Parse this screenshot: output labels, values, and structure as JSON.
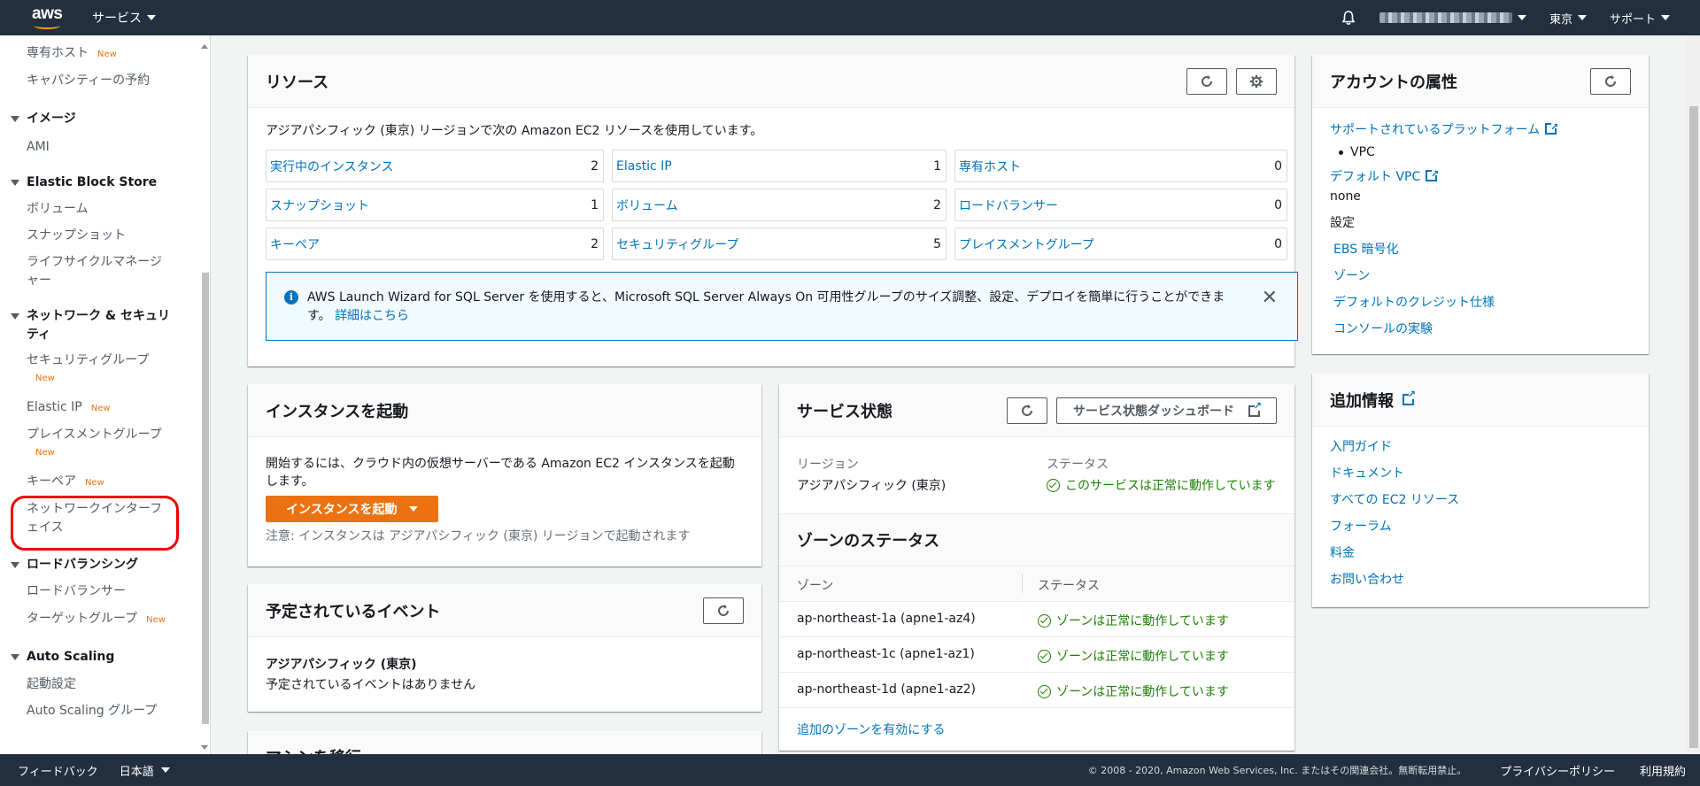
{
  "topnav": {
    "logo": "aws",
    "services": "サービス",
    "account": "",
    "region": "東京",
    "support": "サポート"
  },
  "sidebar": {
    "dedicated_hosts": "専有ホスト",
    "capacity_reservations": "キャパシティーの予約",
    "images_head": "イメージ",
    "ami": "AMI",
    "ebs_head": "Elastic Block Store",
    "volumes": "ボリューム",
    "snapshots": "スナップショット",
    "lifecycle_1": "ライフサイクルマネージ",
    "lifecycle_2": "ャー",
    "network_head_1": "ネットワーク & セキュリ",
    "network_head_2": "ティ",
    "security_groups": "セキュリティグループ",
    "elastic_ip": "Elastic IP",
    "placement_groups": "プレイスメントグループ",
    "key_pairs": "キーペア",
    "network_interfaces_1": "ネットワークインターフ",
    "network_interfaces_2": "ェイス",
    "lb_head": "ロードバランシング",
    "load_balancers": "ロードバランサー",
    "target_groups": "ターゲットグループ",
    "as_head": "Auto Scaling",
    "launch_config": "起動設定",
    "as_groups": "Auto Scaling グループ",
    "new_badge": "New"
  },
  "resources": {
    "title": "リソース",
    "intro": "アジアパシフィック (東京) リージョンで次の Amazon EC2 リソースを使用しています。",
    "cells": [
      {
        "label": "実行中のインスタンス",
        "count": "2"
      },
      {
        "label": "Elastic IP",
        "count": "1"
      },
      {
        "label": "専有ホスト",
        "count": "0"
      },
      {
        "label": "スナップショット",
        "count": "1"
      },
      {
        "label": "ボリューム",
        "count": "2"
      },
      {
        "label": "ロードバランサー",
        "count": "0"
      },
      {
        "label": "キーペア",
        "count": "2"
      },
      {
        "label": "セキュリティグループ",
        "count": "5"
      },
      {
        "label": "プレイスメントグループ",
        "count": "0"
      }
    ],
    "info_text": "AWS Launch Wizard for SQL Server を使用すると、Microsoft SQL Server Always On 可用性グループのサイズ調整、設定、デプロイを簡単に行うことができます。",
    "info_link": "詳細はこちら"
  },
  "account_attrs": {
    "title": "アカウントの属性",
    "supported_platforms": "サポートされているプラットフォーム",
    "vpc": "VPC",
    "default_vpc": "デフォルト VPC",
    "none": "none",
    "settings": "設定",
    "ebs_encryption": "EBS 暗号化",
    "zones": "ゾーン",
    "default_credit": "デフォルトのクレジット仕様",
    "console_experiments": "コンソールの実験"
  },
  "additional_info": {
    "title": "追加情報",
    "links": [
      "入門ガイド",
      "ドキュメント",
      "すべての EC2 リソース",
      "フォーラム",
      "料金",
      "お問い合わせ"
    ]
  },
  "launch": {
    "title": "インスタンスを起動",
    "desc": "開始するには、クラウド内の仮想サーバーである Amazon EC2 インスタンスを起動します。",
    "button": "インスタンスを起動",
    "note": "注意: インスタンスは アジアパシフィック (東京) リージョンで起動されます"
  },
  "events": {
    "title": "予定されているイベント",
    "region": "アジアパシフィック (東京)",
    "none": "予定されているイベントはありません"
  },
  "migrate": {
    "title": "マシンを移行"
  },
  "service_health": {
    "title": "サービス状態",
    "dashboard_button": "サービス状態ダッシュボード",
    "region_label": "リージョン",
    "region_value": "アジアパシフィック (東京)",
    "status_label": "ステータス",
    "status_value": "このサービスは正常に動作しています",
    "zone_status_title": "ゾーンのステータス",
    "col_zone": "ゾーン",
    "col_status": "ステータス",
    "zones": [
      {
        "zone": "ap-northeast-1a (apne1-az4)",
        "status": "ゾーンは正常に動作しています"
      },
      {
        "zone": "ap-northeast-1c (apne1-az1)",
        "status": "ゾーンは正常に動作しています"
      },
      {
        "zone": "ap-northeast-1d (apne1-az2)",
        "status": "ゾーンは正常に動作しています"
      }
    ],
    "enable_zones": "追加のゾーンを有効にする"
  },
  "footer": {
    "feedback": "フィードバック",
    "language": "日本語",
    "copyright": "© 2008 - 2020, Amazon Web Services, Inc. またはその関連会社。無断転用禁止。",
    "privacy": "プライバシーポリシー",
    "terms": "利用規約"
  }
}
